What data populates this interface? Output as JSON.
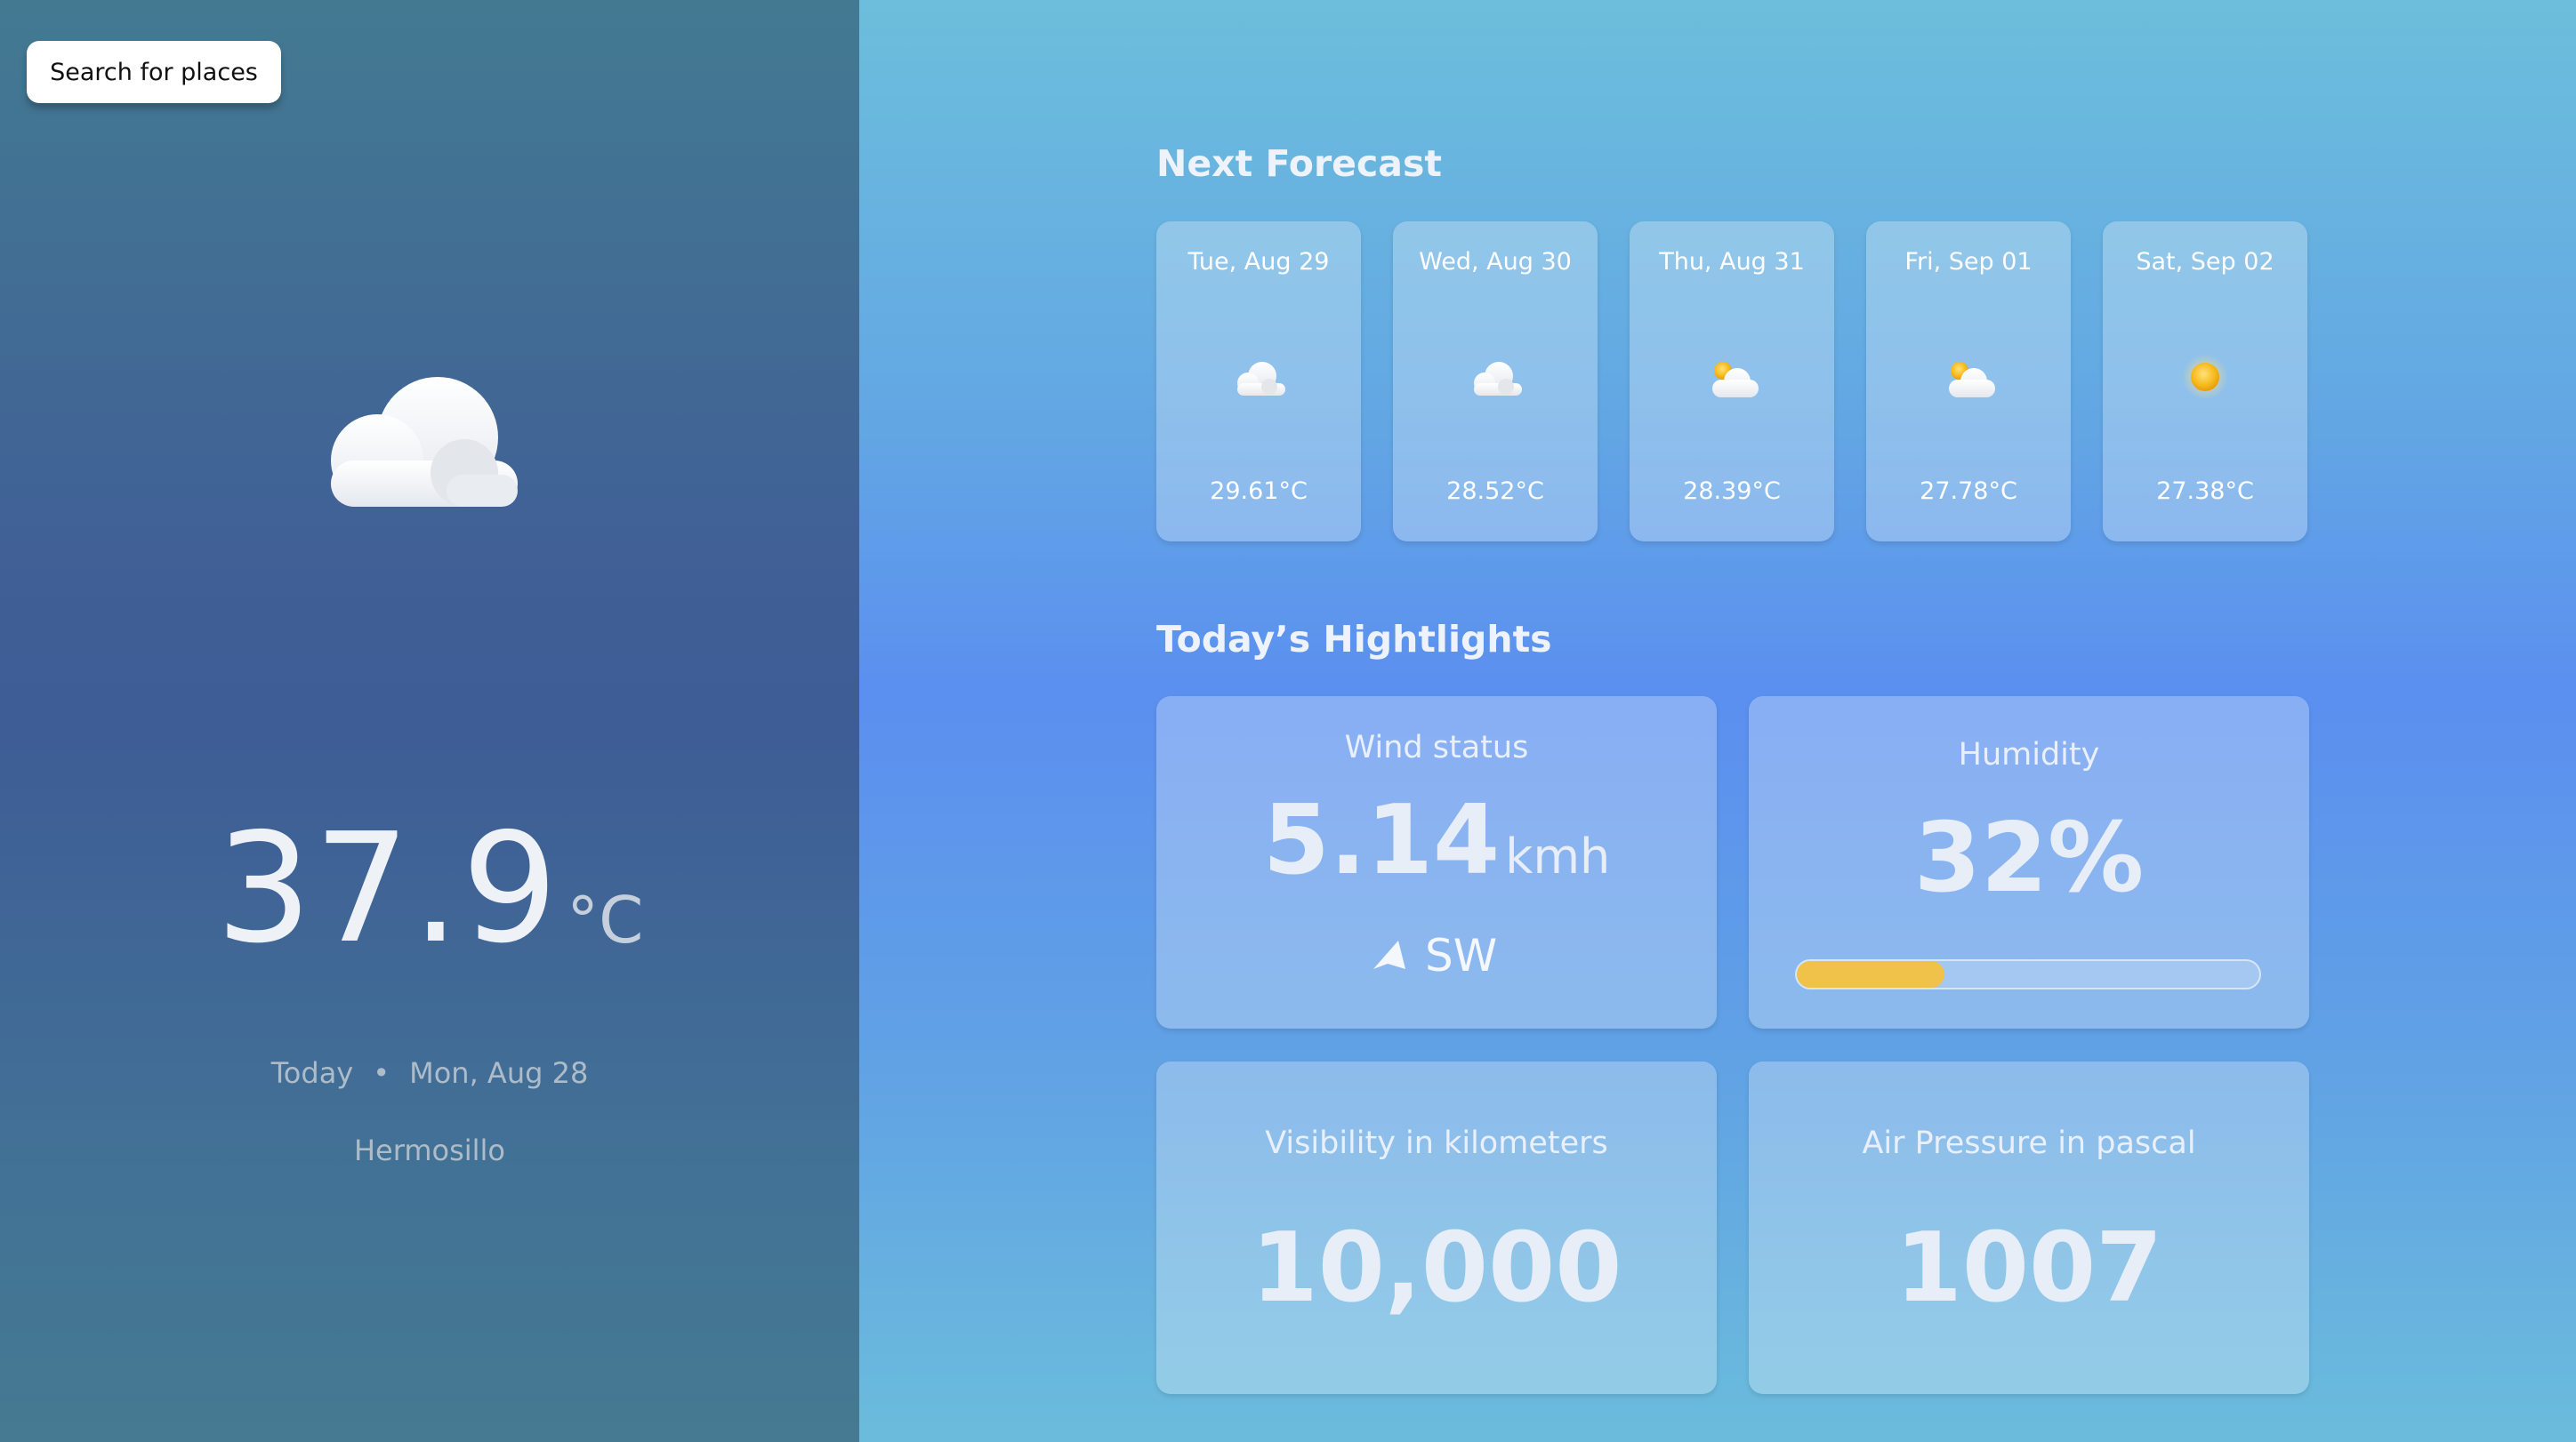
{
  "search": {
    "button_label": "Search for places"
  },
  "current": {
    "icon": "cloud-icon",
    "temperature": "37.9",
    "unit": "°C",
    "day_label": "Today",
    "separator": "•",
    "date": "Mon, Aug 28",
    "location": "Hermosillo"
  },
  "forecast": {
    "title": "Next Forecast",
    "days": [
      {
        "date": "Tue, Aug 29",
        "temp": "29.61°C",
        "icon": "cloud-icon"
      },
      {
        "date": "Wed, Aug 30",
        "temp": "28.52°C",
        "icon": "cloud-icon"
      },
      {
        "date": "Thu, Aug 31",
        "temp": "28.39°C",
        "icon": "partly-sunny-icon"
      },
      {
        "date": "Fri, Sep 01",
        "temp": "27.78°C",
        "icon": "partly-sunny-icon"
      },
      {
        "date": "Sat, Sep 02",
        "temp": "27.38°C",
        "icon": "sun-icon"
      }
    ]
  },
  "highlights": {
    "title": "Today’s Hightlights",
    "wind": {
      "label": "Wind status",
      "value": "5.14",
      "unit": "kmh",
      "direction": "SW",
      "icon": "navigation-arrow-icon"
    },
    "humidity": {
      "label": "Humidity",
      "value": "32%",
      "level_percent": 32,
      "bar_color": "#f0c24a"
    },
    "visibility": {
      "label": "Visibility in kilometers",
      "value": "10,000"
    },
    "pressure": {
      "label": "Air Pressure in pascal",
      "value": "1007"
    }
  }
}
